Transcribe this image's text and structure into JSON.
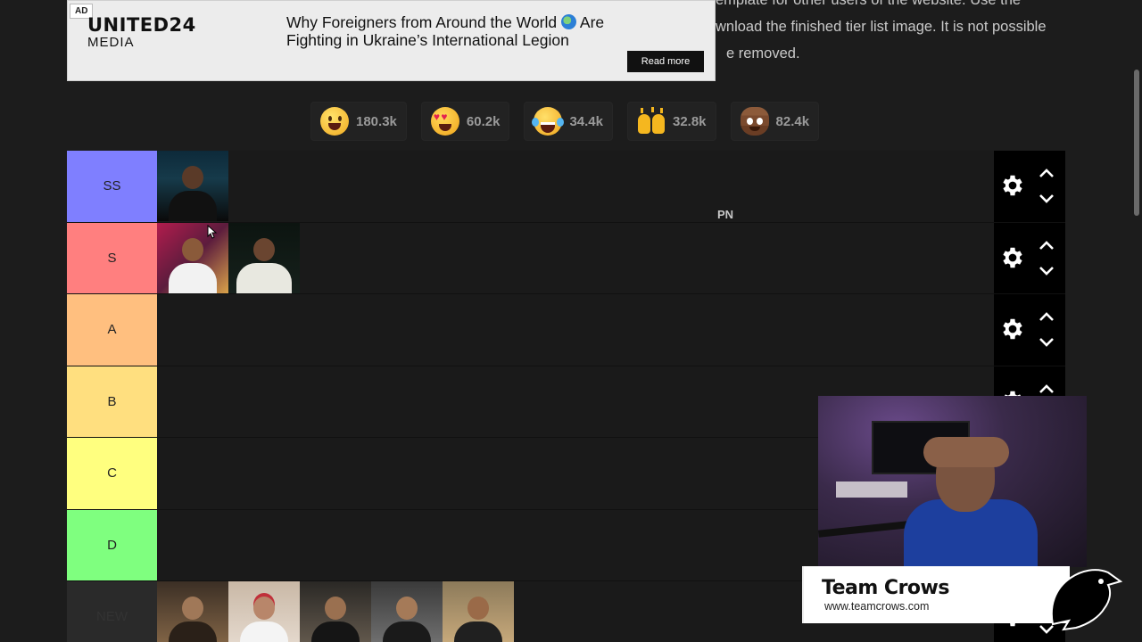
{
  "ad": {
    "tag": "AD",
    "brand_line1": "UNITED24",
    "brand_line2": "MEDIA",
    "headline_part1": "Why Foreigners from Around the World",
    "headline_part2": "Are Fighting in Ukraine’s International Legion",
    "button": "Read more"
  },
  "background_text": {
    "line1": "emplate for other users of the website. Use the",
    "line2": "wnload the finished tier list image. It is not possible",
    "line3": "e removed."
  },
  "reactions": [
    {
      "icon": "grinning-face-icon",
      "count": "180.3k"
    },
    {
      "icon": "heart-eyes-icon",
      "count": "60.2k"
    },
    {
      "icon": "tears-of-joy-icon",
      "count": "34.4k"
    },
    {
      "icon": "raised-hands-icon",
      "count": "32.8k"
    },
    {
      "icon": "poop-icon",
      "count": "82.4k"
    }
  ],
  "tiers": [
    {
      "label": "SS",
      "color": "#7f7fff"
    },
    {
      "label": "S",
      "color": "#ff7f7f"
    },
    {
      "label": "A",
      "color": "#ffbf7f"
    },
    {
      "label": "B",
      "color": "#ffdf7f"
    },
    {
      "label": "C",
      "color": "#ffff7f"
    },
    {
      "label": "D",
      "color": "#7fff7f"
    },
    {
      "label": "NEW",
      "color": "#2a2a2a"
    }
  ],
  "floating_text": "PN",
  "overlay": {
    "team_name": "Team Crows",
    "team_url": "www.teamcrows.com"
  }
}
